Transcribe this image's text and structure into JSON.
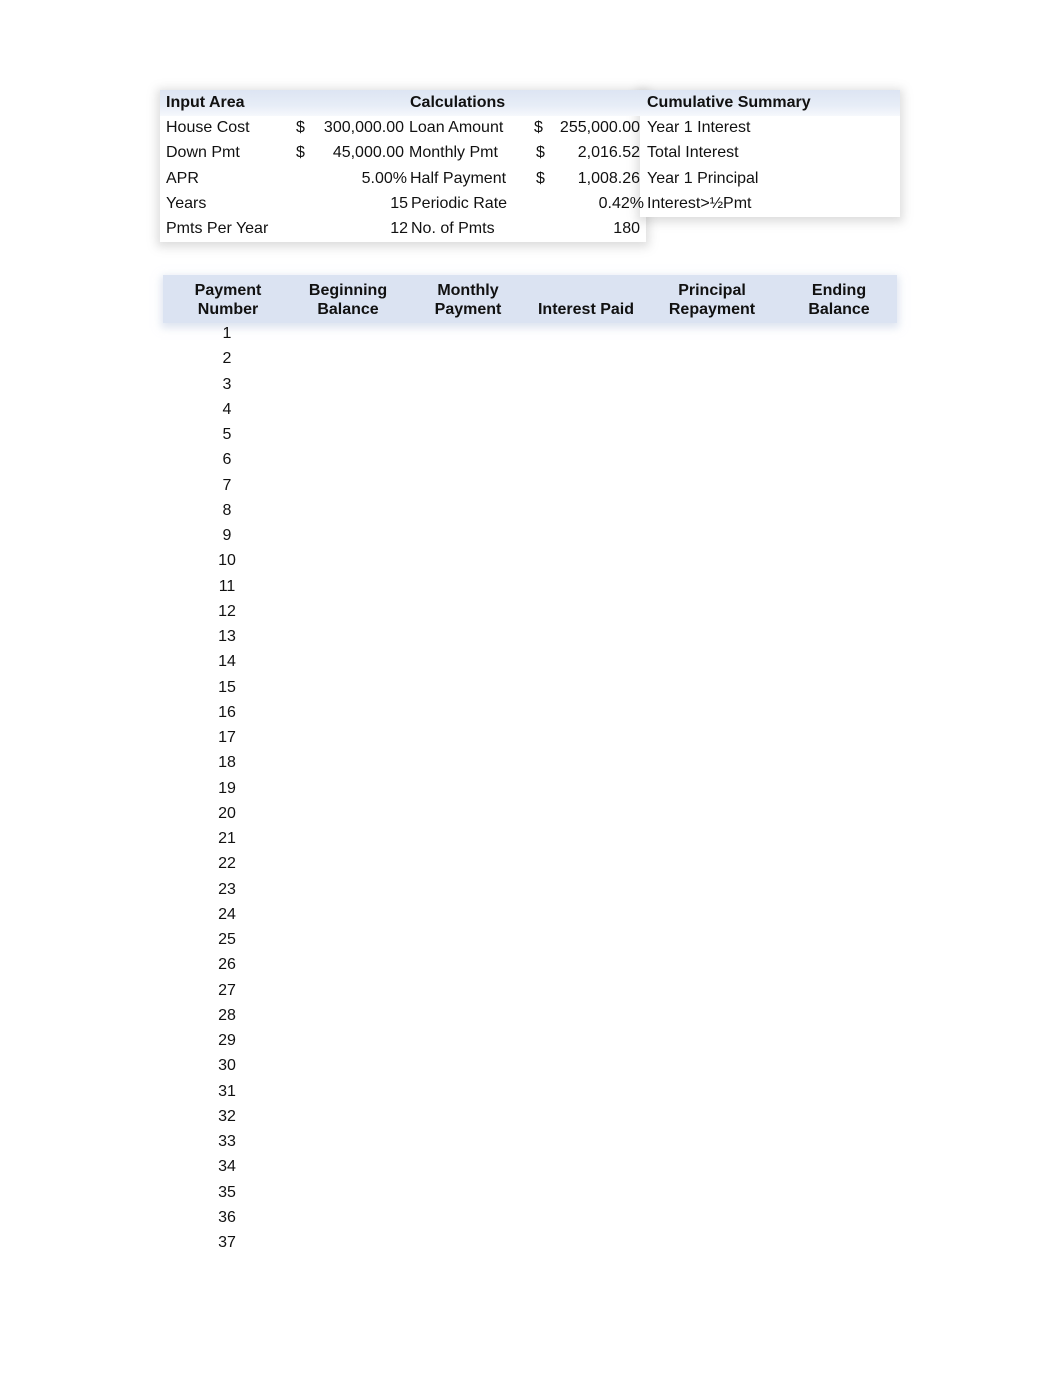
{
  "input_area": {
    "title": "Input Area",
    "rows": [
      {
        "label": "House Cost",
        "currency": "$",
        "value": "300,000.00"
      },
      {
        "label": "Down Pmt",
        "currency": "$",
        "value": "45,000.00"
      },
      {
        "label": "APR",
        "currency": "",
        "value": "5.00%"
      },
      {
        "label": "Years",
        "currency": "",
        "value": "15"
      },
      {
        "label": "Pmts Per Year",
        "currency": "",
        "value": "12"
      }
    ]
  },
  "calculations": {
    "title": "Calculations",
    "rows": [
      {
        "label": "Loan Amount",
        "currency": "$",
        "value": "255,000.00"
      },
      {
        "label": "Monthly Pmt",
        "currency": "$",
        "value": "2,016.52"
      },
      {
        "label": "Half Payment",
        "currency": "$",
        "value": "1,008.26"
      },
      {
        "label": "Periodic Rate",
        "currency": "",
        "value": "0.42%"
      },
      {
        "label": "No. of Pmts",
        "currency": "",
        "value": "180"
      }
    ]
  },
  "cumulative_summary": {
    "title": "Cumulative Summary",
    "rows": [
      {
        "label": "Year 1 Interest",
        "value": ""
      },
      {
        "label": "Total Interest",
        "value": ""
      },
      {
        "label": "Year 1 Principal",
        "value": ""
      },
      {
        "label": "Interest>½Pmt",
        "value": ""
      }
    ]
  },
  "schedule": {
    "columns": [
      {
        "line1": "Payment",
        "line2": "Number"
      },
      {
        "line1": "Beginning",
        "line2": "Balance"
      },
      {
        "line1": "Monthly",
        "line2": "Payment"
      },
      {
        "line1": "",
        "line2": "Interest Paid"
      },
      {
        "line1": "Principal",
        "line2": "Repayment"
      },
      {
        "line1": "Ending",
        "line2": "Balance"
      }
    ],
    "payment_numbers": [
      "1",
      "2",
      "3",
      "4",
      "5",
      "6",
      "7",
      "8",
      "9",
      "10",
      "11",
      "12",
      "13",
      "14",
      "15",
      "16",
      "17",
      "18",
      "19",
      "20",
      "21",
      "22",
      "23",
      "24",
      "25",
      "26",
      "27",
      "28",
      "29",
      "30",
      "31",
      "32",
      "33",
      "34",
      "35",
      "36",
      "37"
    ]
  }
}
